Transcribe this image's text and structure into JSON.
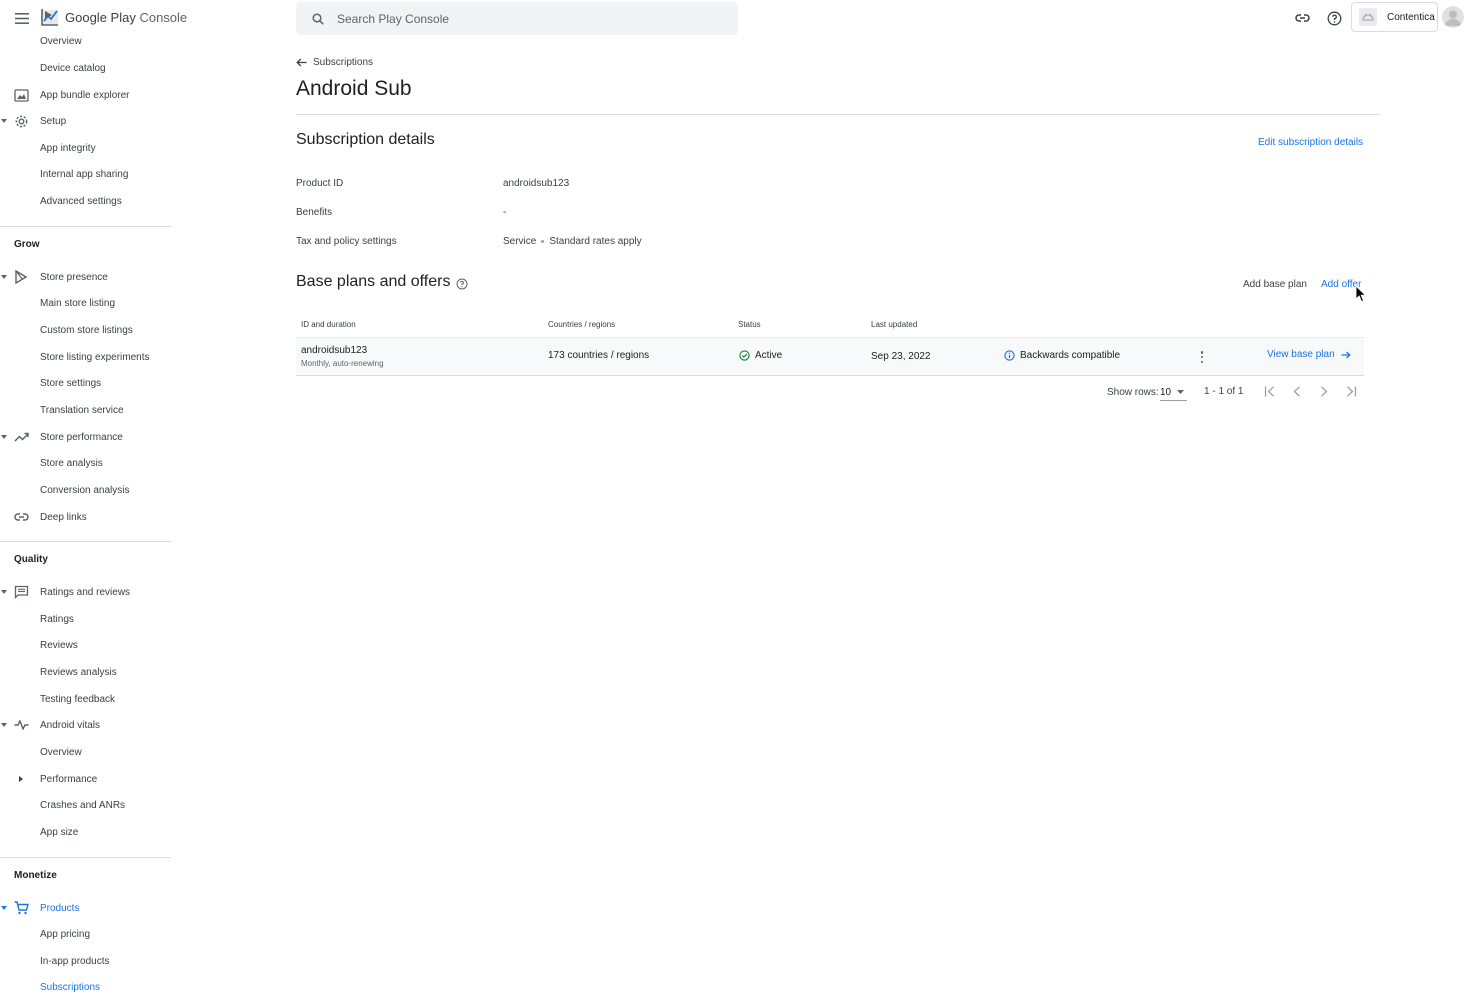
{
  "app": {
    "logo_text_google": "Google Play",
    "logo_text_console": "Console"
  },
  "search": {
    "placeholder": "Search Play Console"
  },
  "account": {
    "name": "Contentica"
  },
  "sidebar": {
    "items": [
      {
        "label": "Overview"
      },
      {
        "label": "Device catalog"
      },
      {
        "label": "App bundle explorer"
      },
      {
        "label": "Setup"
      },
      {
        "label": "App integrity"
      },
      {
        "label": "Internal app sharing"
      },
      {
        "label": "Advanced settings"
      },
      {
        "label": "Store presence"
      },
      {
        "label": "Main store listing"
      },
      {
        "label": "Custom store listings"
      },
      {
        "label": "Store listing experiments"
      },
      {
        "label": "Store settings"
      },
      {
        "label": "Translation service"
      },
      {
        "label": "Store performance"
      },
      {
        "label": "Store analysis"
      },
      {
        "label": "Conversion analysis"
      },
      {
        "label": "Deep links"
      },
      {
        "label": "Ratings and reviews"
      },
      {
        "label": "Ratings"
      },
      {
        "label": "Reviews"
      },
      {
        "label": "Reviews analysis"
      },
      {
        "label": "Testing feedback"
      },
      {
        "label": "Android vitals"
      },
      {
        "label": "Overview"
      },
      {
        "label": "Performance"
      },
      {
        "label": "Crashes and ANRs"
      },
      {
        "label": "App size"
      },
      {
        "label": "Products"
      },
      {
        "label": "App pricing"
      },
      {
        "label": "In-app products"
      },
      {
        "label": "Subscriptions"
      }
    ],
    "sections": {
      "grow": "Grow",
      "quality": "Quality",
      "monetize": "Monetize"
    }
  },
  "breadcrumb": {
    "label": "Subscriptions"
  },
  "page": {
    "title": "Android Sub"
  },
  "details": {
    "title": "Subscription details",
    "edit_label": "Edit subscription details",
    "product_id_label": "Product ID",
    "product_id_value": "androidsub123",
    "benefits_label": "Benefits",
    "benefits_value": "-",
    "tax_label": "Tax and policy settings",
    "tax_value_1": "Service",
    "tax_value_2": "Standard rates apply"
  },
  "plans": {
    "title": "Base plans and offers",
    "add_base_plan_label": "Add base plan",
    "add_offer_label": "Add offer",
    "columns": [
      "ID and duration",
      "Countries / regions",
      "Status",
      "Last updated"
    ],
    "rows": [
      {
        "id": "androidsub123",
        "duration": "Monthly, auto-renewing",
        "regions": "173 countries / regions",
        "status": "Active",
        "updated": "Sep 23, 2022",
        "compat": "Backwards compatible",
        "action": "View base plan"
      }
    ]
  },
  "pagination": {
    "show_rows_label": "Show rows:",
    "rows_value": "10",
    "range": "1 - 1 of 1"
  },
  "colors": {
    "accent": "#1a73e8",
    "status_active": "#188038"
  }
}
